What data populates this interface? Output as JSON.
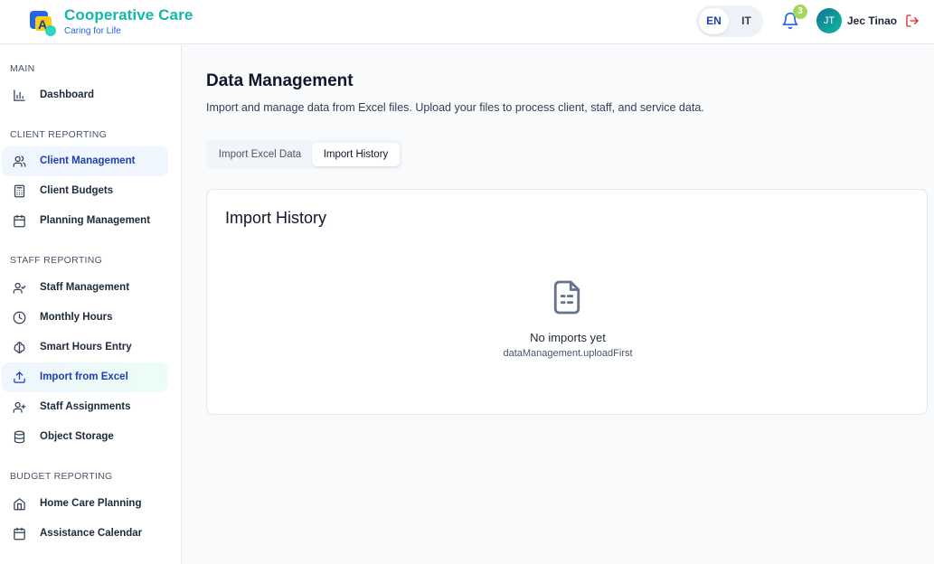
{
  "brand": {
    "title": "Cooperative Care",
    "subtitle": "Caring for Life"
  },
  "header": {
    "languages": [
      "EN",
      "IT"
    ],
    "active_language": "EN",
    "notification_count": "3",
    "user_initials": "JT",
    "user_name": "Jec Tinao"
  },
  "sidebar": {
    "main": {
      "title": "MAIN",
      "items": [
        {
          "label": "Dashboard",
          "icon": "bar-chart-icon"
        }
      ]
    },
    "client_reporting": {
      "title": "CLIENT REPORTING",
      "items": [
        {
          "label": "Client Management",
          "icon": "users-icon"
        },
        {
          "label": "Client Budgets",
          "icon": "calculator-icon"
        },
        {
          "label": "Planning Management",
          "icon": "calendar-icon"
        }
      ]
    },
    "staff_reporting": {
      "title": "STAFF REPORTING",
      "items": [
        {
          "label": "Staff Management",
          "icon": "user-check-icon"
        },
        {
          "label": "Monthly Hours",
          "icon": "clock-icon"
        },
        {
          "label": "Smart Hours Entry",
          "icon": "brain-icon"
        },
        {
          "label": "Import from Excel",
          "icon": "upload-icon"
        },
        {
          "label": "Staff Assignments",
          "icon": "user-plus-icon"
        },
        {
          "label": "Object Storage",
          "icon": "database-icon"
        }
      ]
    },
    "budget_reporting": {
      "title": "BUDGET REPORTING",
      "items": [
        {
          "label": "Home Care Planning",
          "icon": "home-icon"
        },
        {
          "label": "Assistance Calendar",
          "icon": "calendar-icon"
        }
      ]
    }
  },
  "main": {
    "title": "Data Management",
    "description": "Import and manage data from Excel files. Upload your files to process client, staff, and service data.",
    "tabs": [
      {
        "label": "Import Excel Data"
      },
      {
        "label": "Import History"
      }
    ],
    "active_tab": "Import History",
    "card": {
      "title": "Import History",
      "empty_title": "No imports yet",
      "empty_subtitle": "dataManagement.uploadFirst",
      "icon": "file-text-icon"
    }
  },
  "colors": {
    "brand_teal": "#14b8a6",
    "active_blue": "#1e40af",
    "badge_green": "#a3d65c",
    "logout_red": "#dc2626"
  }
}
